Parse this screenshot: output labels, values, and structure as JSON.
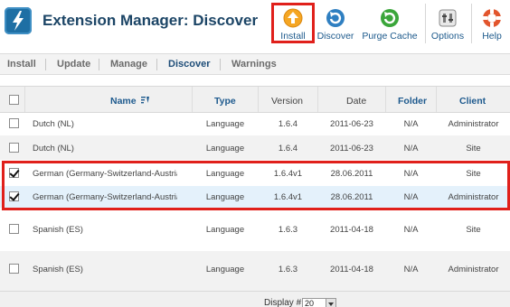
{
  "header": {
    "title": "Extension Manager: Discover",
    "toolbar": [
      {
        "label": "Install",
        "icon": "install-icon",
        "color": "#f59e0b"
      },
      {
        "label": "Discover",
        "icon": "discover-icon",
        "color": "#2f7fc1"
      },
      {
        "label": "Purge Cache",
        "icon": "purge-cache-icon",
        "color": "#3aa63a"
      },
      {
        "label": "Options",
        "icon": "options-icon",
        "color": "#777777"
      },
      {
        "label": "Help",
        "icon": "help-icon",
        "color": "#e2552d"
      }
    ]
  },
  "submenu": {
    "tabs": [
      "Install",
      "Update",
      "Manage",
      "Discover",
      "Warnings"
    ],
    "active": "Discover"
  },
  "table": {
    "headers": {
      "name": "Name",
      "type": "Type",
      "version": "Version",
      "date": "Date",
      "folder": "Folder",
      "client": "Client"
    },
    "rows": [
      {
        "checked": false,
        "name": "Dutch (NL)",
        "type": "Language",
        "version": "1.6.4",
        "date": "2011-06-23",
        "folder": "N/A",
        "client": "Administrator"
      },
      {
        "checked": false,
        "name": "Dutch (NL)",
        "type": "Language",
        "version": "1.6.4",
        "date": "2011-06-23",
        "folder": "N/A",
        "client": "Site"
      },
      {
        "checked": true,
        "name": "German (Germany-Switzerland-Austria)",
        "type": "Language",
        "version": "1.6.4v1",
        "date": "28.06.2011",
        "folder": "N/A",
        "client": "Site"
      },
      {
        "checked": true,
        "name": "German (Germany-Switzerland-Austria)",
        "type": "Language",
        "version": "1.6.4v1",
        "date": "28.06.2011",
        "folder": "N/A",
        "client": "Administrator"
      },
      {
        "checked": false,
        "name": "Spanish (ES)",
        "type": "Language",
        "version": "1.6.3",
        "date": "2011-04-18",
        "folder": "N/A",
        "client": "Site"
      },
      {
        "checked": false,
        "name": "Spanish (ES)",
        "type": "Language",
        "version": "1.6.3",
        "date": "2011-04-18",
        "folder": "N/A",
        "client": "Administrator"
      }
    ]
  },
  "footer": {
    "display_label": "Display #",
    "display_value": "20"
  }
}
